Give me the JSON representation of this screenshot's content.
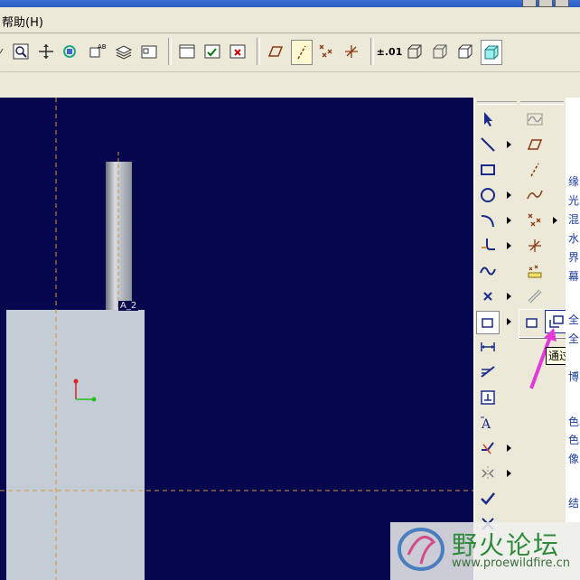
{
  "menu": {
    "help_label": "帮助(H)"
  },
  "toolbar": {
    "precision_label": "±.01"
  },
  "canvas": {
    "background": "#05064d",
    "part_fill": "#c4ccd6",
    "shaft_label": "A_2",
    "axis_color": "#d8923a"
  },
  "sketch_tools": [
    "select-icon",
    "line-icon",
    "rectangle-icon",
    "circle-icon",
    "arc-icon",
    "fillet-icon",
    "spline-icon",
    "point-icon",
    "offset-edge-icon",
    "dimension-icon",
    "modify-icon",
    "constraint-icon",
    "text-icon",
    "trim-icon",
    "mirror-icon",
    "done-check-icon",
    "quit-x-icon"
  ],
  "reference_tools": [
    "datum-curve-icon",
    "datum-plane-icon",
    "datum-axis-icon",
    "sketched-curve-icon",
    "datum-point-icon",
    "coordinate-system-icon",
    "analysis-icon",
    "measure-icon"
  ],
  "flyout": {
    "items": [
      "use-edge-icon",
      "offset-edge-icon"
    ]
  },
  "tooltip": {
    "text": "通过"
  },
  "side_text": [
    "缘",
    "光",
    "混",
    "水",
    "界",
    "幕",
    "全",
    "全",
    "博",
    "色",
    "色",
    "像",
    "结"
  ],
  "watermark": {
    "title": "野火论坛",
    "url": "www.proewildfire.cn"
  }
}
